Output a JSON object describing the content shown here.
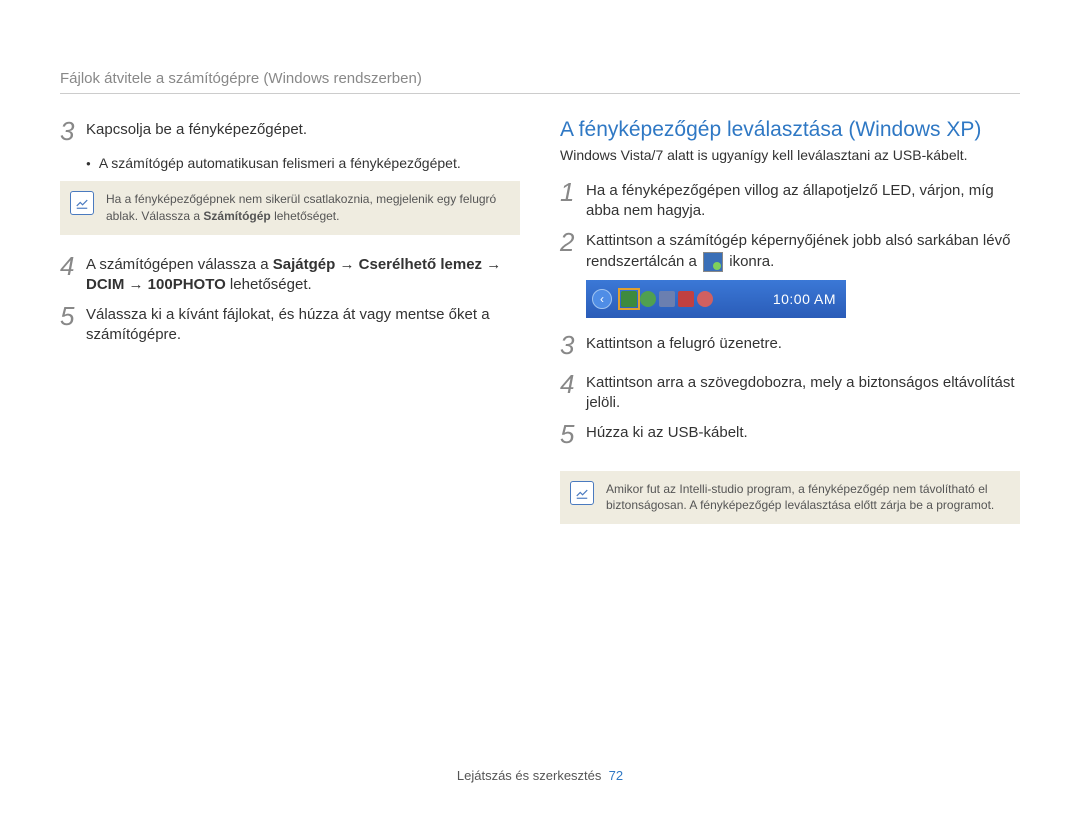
{
  "header": {
    "title": "Fájlok átvitele a számítógépre (Windows rendszerben)"
  },
  "left": {
    "step3": "Kapcsolja be a fényképezőgépet.",
    "bullet3": "A számítógép automatikusan felismeri a fényképezőgépet.",
    "note1_a": "Ha a fényképezőgépnek nem sikerül csatlakoznia, megjelenik egy felugró ablak. Válassza a ",
    "note1_b": "Számítógép",
    "note1_c": " lehetőséget.",
    "step4_a": "A számítógépen válassza a ",
    "step4_b": "Sajátgép",
    "step4_arrow1": " → ",
    "step4_c": "Cserélhető lemez",
    "step4_arrow2": " → ",
    "step4_d": "DCIM",
    "step4_arrow3": " → ",
    "step4_e": "100PHOTO",
    "step4_f": " lehetőséget.",
    "step5": "Válassza ki a kívánt fájlokat, és húzza át vagy mentse őket a számítógépre."
  },
  "right": {
    "section_title": "A fényképezőgép leválasztása (Windows XP)",
    "sub": "Windows Vista/7 alatt is ugyanígy kell leválasztani az USB-kábelt.",
    "step1": "Ha a fényképezőgépen villog az állapotjelző LED, várjon, míg abba nem hagyja.",
    "step2_a": "Kattintson a számítógép képernyőjének jobb alsó sarkában lévő rendszertálcán a ",
    "step2_b": " ikonra.",
    "taskbar_time": "10:00 AM",
    "step3": "Kattintson a felugró üzenetre.",
    "step4": "Kattintson arra a szövegdobozra, mely a biztonságos eltávolítást jelöli.",
    "step5": "Húzza ki az USB-kábelt.",
    "note2": "Amikor fut az Intelli-studio program, a fényképezőgép nem távolítható el biztonságosan. A fényképezőgép leválasztása előtt zárja be a programot."
  },
  "footer": {
    "label": "Lejátszás és szerkesztés",
    "page": "72"
  },
  "nums": {
    "n1": "1",
    "n2": "2",
    "n3": "3",
    "n4": "4",
    "n5": "5"
  }
}
